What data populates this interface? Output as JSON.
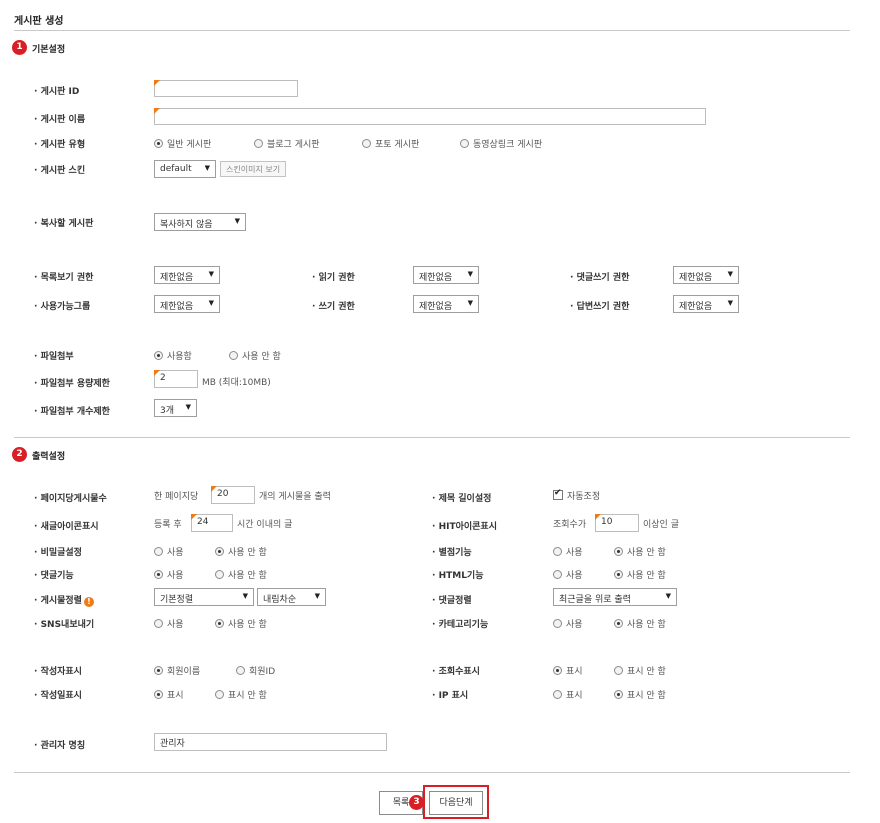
{
  "page_title": "게시판 생성",
  "sections": {
    "basic": {
      "badge": "1",
      "title": "기본설정"
    },
    "output": {
      "badge": "2",
      "title": "출력설정"
    }
  },
  "basic": {
    "board_id": {
      "label": "게시판 ID",
      "value": ""
    },
    "board_name": {
      "label": "게시판 이름",
      "value": ""
    },
    "board_type": {
      "label": "게시판 유형",
      "options": [
        "일반 게시판",
        "블로그 게시판",
        "포토 게시판",
        "동영상링크 게시판"
      ],
      "selected": 0
    },
    "board_skin": {
      "label": "게시판 스킨",
      "value": "default",
      "preview_button": "스킨이미지 보기"
    },
    "copy_board": {
      "label": "복사할 게시판",
      "value": "복사하지 않음"
    },
    "permissions": {
      "list_view": {
        "label": "목록보기 권한",
        "value": "제한없음"
      },
      "read": {
        "label": "읽기 권한",
        "value": "제한없음"
      },
      "comment_write": {
        "label": "댓글쓰기 권한",
        "value": "제한없음"
      },
      "usable_group": {
        "label": "사용가능그룹",
        "value": "제한없음"
      },
      "write": {
        "label": "쓰기 권한",
        "value": "제한없음"
      },
      "reply_write": {
        "label": "답변쓰기 권한",
        "value": "제한없음"
      }
    },
    "attach": {
      "label": "파일첨부",
      "options": [
        "사용함",
        "사용 안 함"
      ],
      "selected": 0
    },
    "attach_size": {
      "label": "파일첨부 용량제한",
      "value": "2",
      "unit": "MB (최대:10MB)"
    },
    "attach_count": {
      "label": "파일첨부 개수제한",
      "value": "3개"
    }
  },
  "output": {
    "posts_per_page": {
      "label": "페이지당게시물수",
      "prefix": "한 페이지당",
      "value": "20",
      "suffix": "개의 게시물을 출력"
    },
    "title_length": {
      "label": "제목 길이설정",
      "checkbox_label": "자동조정",
      "checked": true
    },
    "new_icon": {
      "label": "새글아이콘표시",
      "prefix": "등록 후",
      "value": "24",
      "suffix": "시간 이내의 글"
    },
    "hit_icon": {
      "label": "HIT아이콘표시",
      "prefix": "조회수가",
      "value": "10",
      "suffix": "이상인 글"
    },
    "secret_post": {
      "label": "비밀글설정",
      "options": [
        "사용",
        "사용 안 함"
      ],
      "selected": 1
    },
    "rating": {
      "label": "별점기능",
      "options": [
        "사용",
        "사용 안 함"
      ],
      "selected": 1
    },
    "comments": {
      "label": "댓글기능",
      "options": [
        "사용",
        "사용 안 함"
      ],
      "selected": 0
    },
    "html": {
      "label": "HTML기능",
      "options": [
        "사용",
        "사용 안 함"
      ],
      "selected": 1
    },
    "post_sort": {
      "label": "게시물정렬",
      "info_icon": "!",
      "value": "기본정렬",
      "order": "내림차순"
    },
    "comment_sort": {
      "label": "댓글정렬",
      "value": "최근글을 위로 출력"
    },
    "sns": {
      "label": "SNS내보내기",
      "options": [
        "사용",
        "사용 안 함"
      ],
      "selected": 1
    },
    "category": {
      "label": "카테고리기능",
      "options": [
        "사용",
        "사용 안 함"
      ],
      "selected": 1
    },
    "author_display": {
      "label": "작성자표시",
      "options": [
        "회원이름",
        "회원ID"
      ],
      "selected": 0
    },
    "views_display": {
      "label": "조회수표시",
      "options": [
        "표시",
        "표시 안 함"
      ],
      "selected": 0
    },
    "date_display": {
      "label": "작성일표시",
      "options": [
        "표시",
        "표시 안 함"
      ],
      "selected": 0
    },
    "ip_display": {
      "label": "IP 표시",
      "options": [
        "표시",
        "표시 안 함"
      ],
      "selected": 1
    },
    "admin_name": {
      "label": "관리자 명칭",
      "value": "관리자"
    }
  },
  "footer": {
    "list_button": "목록",
    "next_button": "다음단계",
    "next_badge": "3"
  }
}
